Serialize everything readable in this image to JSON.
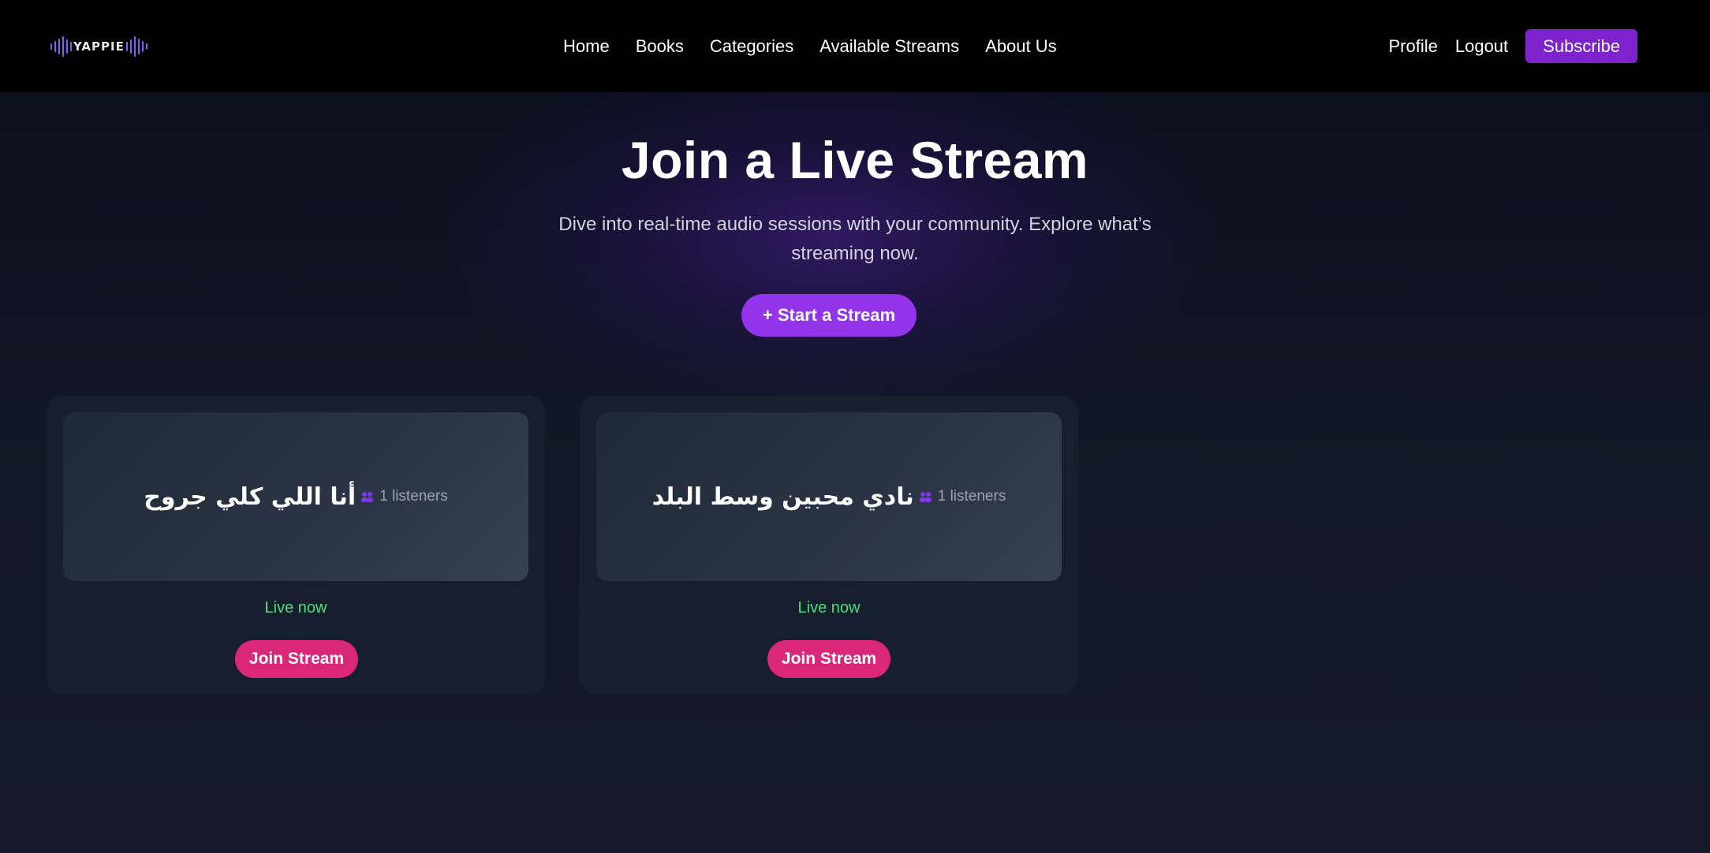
{
  "brand": {
    "logo_text": "YAPPIE",
    "accent": "#8b5cf6"
  },
  "nav": {
    "links": [
      "Home",
      "Books",
      "Categories",
      "Available Streams",
      "About Us"
    ],
    "profile": "Profile",
    "logout": "Logout",
    "subscribe": "Subscribe"
  },
  "hero": {
    "title": "Join a Live Stream",
    "subtitle": "Dive into real-time audio sessions with your community. Explore what’s streaming now.",
    "start_button": "+ Start a Stream"
  },
  "streams": [
    {
      "title": "أنا اللي كلي جروح",
      "listeners": "1 listeners",
      "status": "Live now",
      "join_label": "Join Stream"
    },
    {
      "title": "نادي محبين وسط البلد",
      "listeners": "1 listeners",
      "status": "Live now",
      "join_label": "Join Stream"
    }
  ],
  "colors": {
    "subscribe_bg": "#7e22ce",
    "start_bg": "#9333ea",
    "join_bg": "#db2777",
    "live_green": "#4ade80",
    "people_icon": "#7c3aed"
  },
  "icons": {
    "listeners": "people-icon",
    "logo": "audio-wave-icon"
  }
}
